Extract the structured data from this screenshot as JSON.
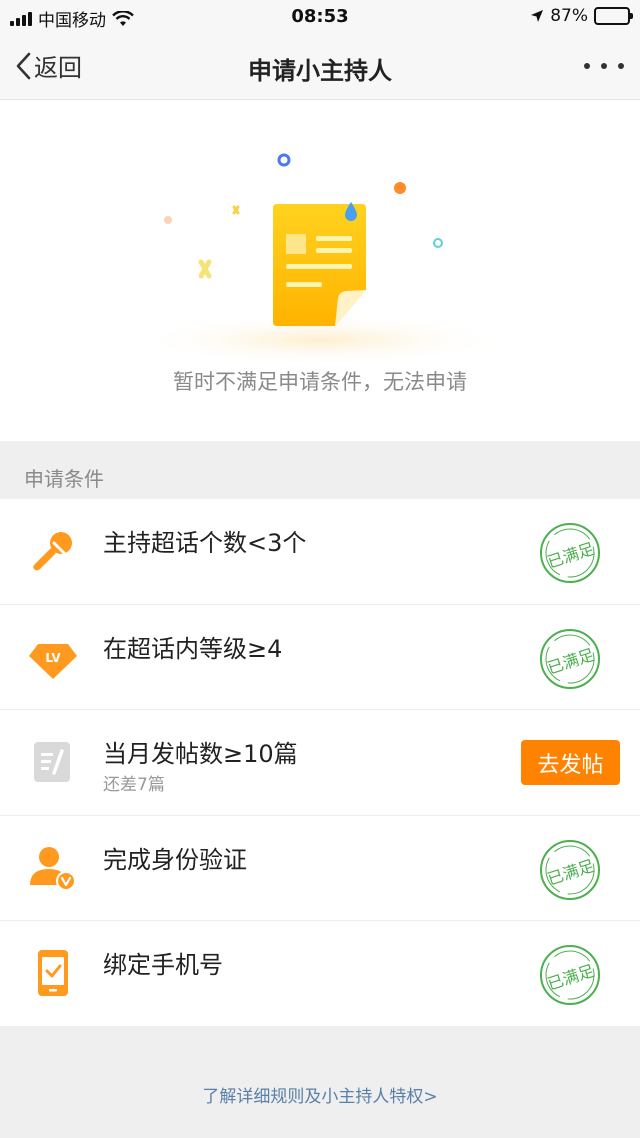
{
  "status_bar": {
    "carrier": "中国移动",
    "time": "08:53",
    "battery": "87%"
  },
  "navbar": {
    "back_label": "返回",
    "title": "申请小主持人"
  },
  "hero": {
    "message": "暂时不满足申请条件，无法申请"
  },
  "conditions": {
    "header": "申请条件",
    "items": [
      {
        "icon": "microphone-icon",
        "title": "主持超话个数<3个",
        "status": "已满足"
      },
      {
        "icon": "level-badge-icon",
        "icon_text": "LV",
        "title": "在超话内等级≥4",
        "status": "已满足"
      },
      {
        "icon": "post-icon",
        "title": "当月发帖数≥10篇",
        "subtitle": "还差7篇",
        "action": "去发帖"
      },
      {
        "icon": "verified-user-icon",
        "title": "完成身份验证",
        "status": "已满足"
      },
      {
        "icon": "phone-check-icon",
        "title": "绑定手机号",
        "status": "已满足"
      }
    ]
  },
  "footer": {
    "link": "了解详细规则及小主持人特权>"
  },
  "colors": {
    "accent": "#ff8200",
    "satisfied": "#4caf50",
    "link": "#5a7fa8"
  }
}
